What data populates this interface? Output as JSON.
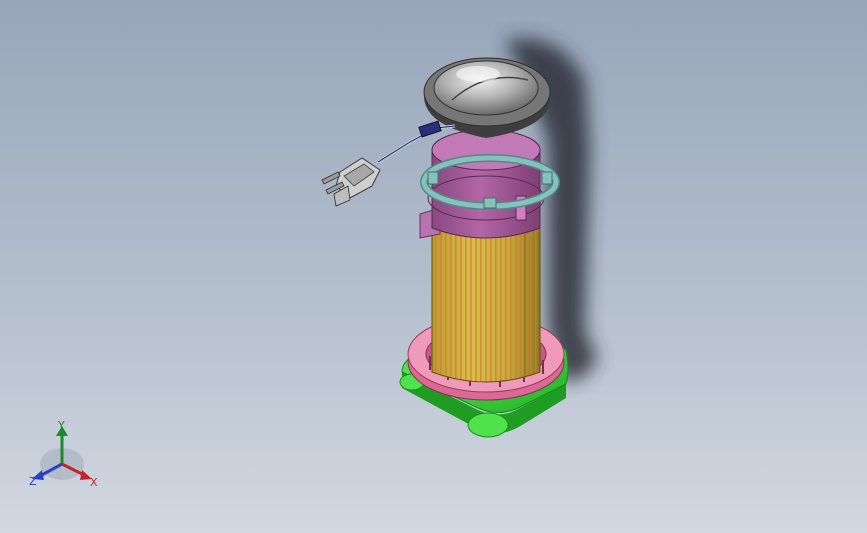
{
  "triad": {
    "x_label": "X",
    "y_label": "Y",
    "z_label": "Z"
  },
  "colors": {
    "x_axis": "#c0262c",
    "y_axis": "#1f8a2a",
    "z_axis": "#2a41c2",
    "lid": "#5e5e5e",
    "upper_housing": "#a85b9c",
    "clip_ring": "#79b1ad",
    "filter_body": "#c9ab39",
    "base_ring": "#e27ea0",
    "base_plate": "#36d93a"
  }
}
